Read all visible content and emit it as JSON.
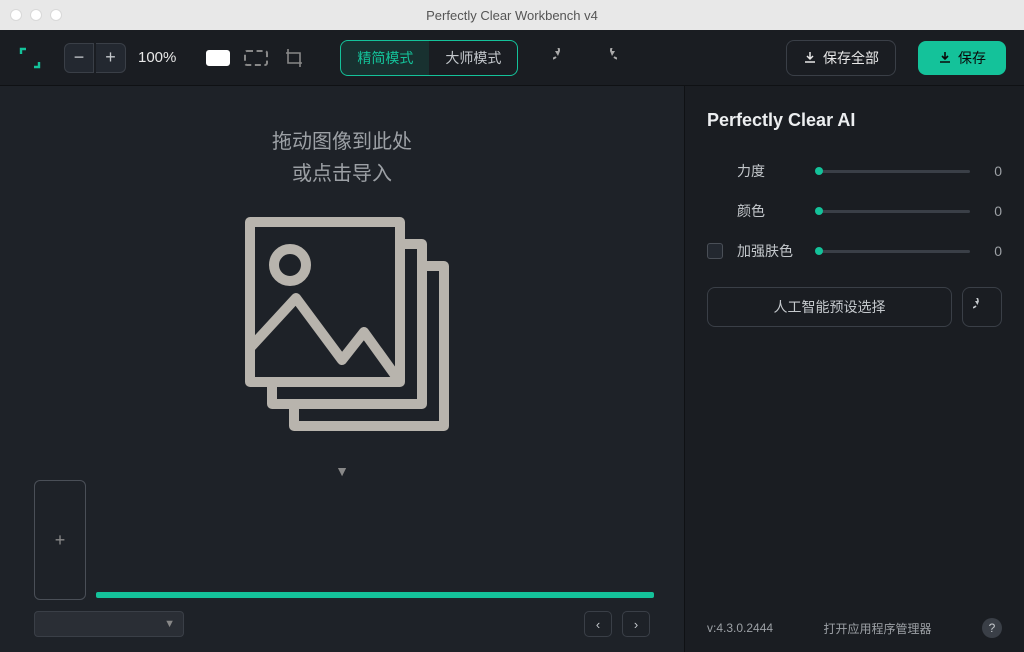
{
  "window": {
    "title": "Perfectly Clear Workbench v4"
  },
  "toolbar": {
    "zoom_value": "100%",
    "mode_simple": "精简模式",
    "mode_master": "大师模式",
    "save_all": "保存全部",
    "save": "保存"
  },
  "canvas": {
    "drop_line1": "拖动图像到此处",
    "drop_line2": "或点击导入"
  },
  "panel": {
    "title": "Perfectly Clear AI",
    "sliders": [
      {
        "label": "力度",
        "value": "0",
        "checkbox": false
      },
      {
        "label": "颜色",
        "value": "0",
        "checkbox": false
      },
      {
        "label": "加强肤色",
        "value": "0",
        "checkbox": true
      }
    ],
    "preset_button": "人工智能预设选择"
  },
  "footer": {
    "version": "v:4.3.0.2444",
    "app_manager": "打开应用程序管理器"
  },
  "colors": {
    "accent": "#14c29a"
  }
}
